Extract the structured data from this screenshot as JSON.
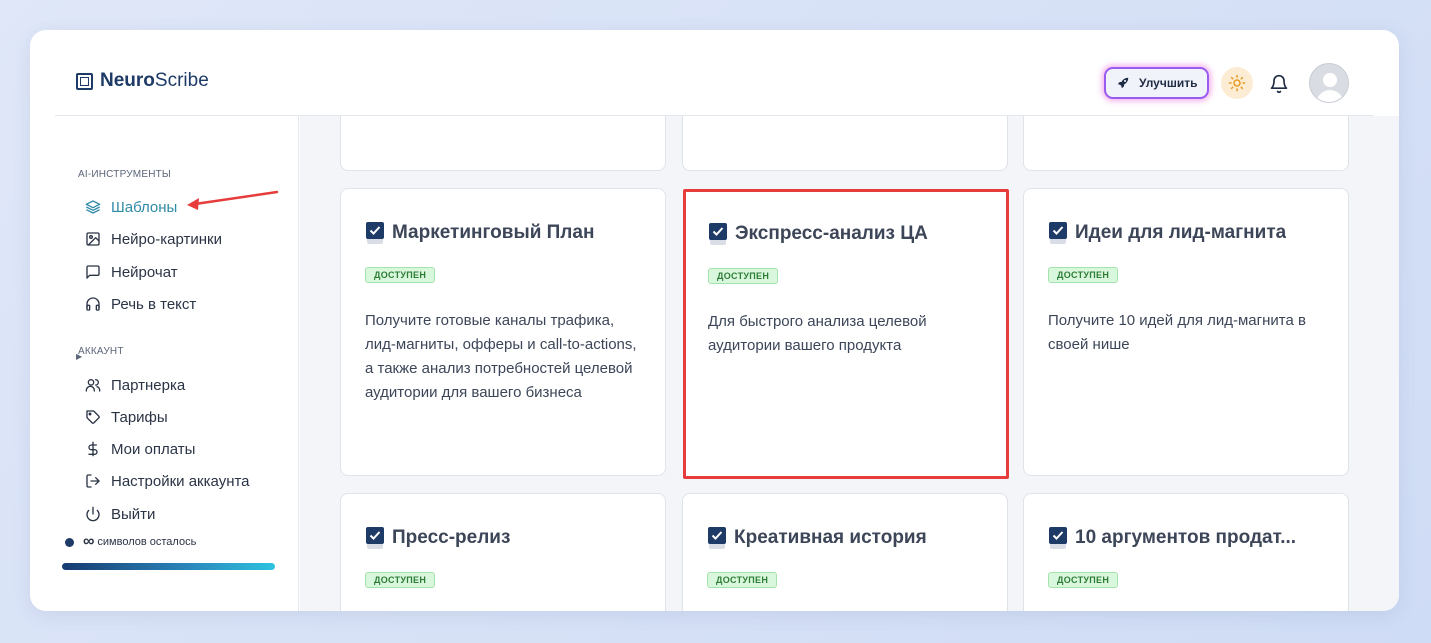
{
  "app": {
    "logo_bold": "Neuro",
    "logo_regular": "Scribe"
  },
  "header": {
    "upgrade_label": "Улучшить",
    "accent_color": "#9a5cf0"
  },
  "sidebar": {
    "tools_title": "AI-ИНСТРУМЕНТЫ",
    "tools": [
      {
        "label": "Шаблоны",
        "icon": "layers-icon",
        "active": true
      },
      {
        "label": "Нейро-картинки",
        "icon": "image-icon"
      },
      {
        "label": "Нейрочат",
        "icon": "chat-icon"
      },
      {
        "label": "Речь в текст",
        "icon": "headphones-icon"
      }
    ],
    "account_title": "АККАУНТ",
    "account": [
      {
        "label": "Партнерка",
        "icon": "users-icon"
      },
      {
        "label": "Тарифы",
        "icon": "tag-icon"
      },
      {
        "label": "Мои оплаты",
        "icon": "dollar-icon"
      },
      {
        "label": "Настройки аккаунта",
        "icon": "logout-arrow-icon"
      },
      {
        "label": "Выйти",
        "icon": "power-icon"
      }
    ],
    "chars_infinity": "∞",
    "chars_label": "символов осталось",
    "chars_progress": 1.0
  },
  "cards": [
    {
      "title": "Маркетинговый План",
      "badge": "ДОСТУПЕН",
      "desc": "Получите готовые каналы трафика, лид-магниты, офферы и call-to-actions, а также анализ потребностей целевой аудитории для вашего бизнеса"
    },
    {
      "title": "Экспресс-анализ ЦА",
      "badge": "ДОСТУПЕН",
      "desc": "Для быстрого анализа целевой аудитории вашего продукта"
    },
    {
      "title": "Идеи для лид-магнита",
      "badge": "ДОСТУПЕН",
      "desc": "Получите 10 идей для лид-магнита в своей нише"
    },
    {
      "title": "Пресс-релиз",
      "badge": "ДОСТУПЕН",
      "desc": ""
    },
    {
      "title": "Креативная история",
      "badge": "ДОСТУПЕН",
      "desc": ""
    },
    {
      "title": "10 аргументов продат...",
      "badge": "ДОСТУПЕН",
      "desc": ""
    }
  ]
}
